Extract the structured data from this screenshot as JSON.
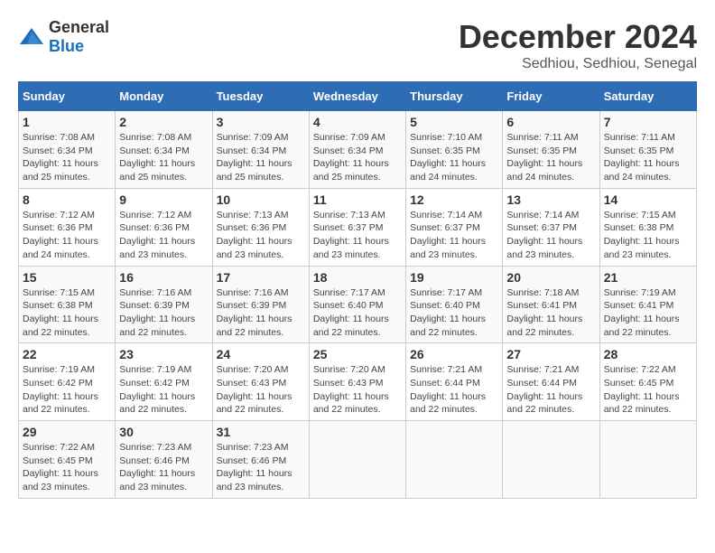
{
  "logo": {
    "general": "General",
    "blue": "Blue"
  },
  "title": {
    "month": "December 2024",
    "location": "Sedhiou, Sedhiou, Senegal"
  },
  "headers": [
    "Sunday",
    "Monday",
    "Tuesday",
    "Wednesday",
    "Thursday",
    "Friday",
    "Saturday"
  ],
  "weeks": [
    [
      {
        "day": "1",
        "sunrise": "7:08 AM",
        "sunset": "6:34 PM",
        "daylight": "11 hours and 25 minutes."
      },
      {
        "day": "2",
        "sunrise": "7:08 AM",
        "sunset": "6:34 PM",
        "daylight": "11 hours and 25 minutes."
      },
      {
        "day": "3",
        "sunrise": "7:09 AM",
        "sunset": "6:34 PM",
        "daylight": "11 hours and 25 minutes."
      },
      {
        "day": "4",
        "sunrise": "7:09 AM",
        "sunset": "6:34 PM",
        "daylight": "11 hours and 25 minutes."
      },
      {
        "day": "5",
        "sunrise": "7:10 AM",
        "sunset": "6:35 PM",
        "daylight": "11 hours and 24 minutes."
      },
      {
        "day": "6",
        "sunrise": "7:11 AM",
        "sunset": "6:35 PM",
        "daylight": "11 hours and 24 minutes."
      },
      {
        "day": "7",
        "sunrise": "7:11 AM",
        "sunset": "6:35 PM",
        "daylight": "11 hours and 24 minutes."
      }
    ],
    [
      {
        "day": "8",
        "sunrise": "7:12 AM",
        "sunset": "6:36 PM",
        "daylight": "11 hours and 24 minutes."
      },
      {
        "day": "9",
        "sunrise": "7:12 AM",
        "sunset": "6:36 PM",
        "daylight": "11 hours and 23 minutes."
      },
      {
        "day": "10",
        "sunrise": "7:13 AM",
        "sunset": "6:36 PM",
        "daylight": "11 hours and 23 minutes."
      },
      {
        "day": "11",
        "sunrise": "7:13 AM",
        "sunset": "6:37 PM",
        "daylight": "11 hours and 23 minutes."
      },
      {
        "day": "12",
        "sunrise": "7:14 AM",
        "sunset": "6:37 PM",
        "daylight": "11 hours and 23 minutes."
      },
      {
        "day": "13",
        "sunrise": "7:14 AM",
        "sunset": "6:37 PM",
        "daylight": "11 hours and 23 minutes."
      },
      {
        "day": "14",
        "sunrise": "7:15 AM",
        "sunset": "6:38 PM",
        "daylight": "11 hours and 23 minutes."
      }
    ],
    [
      {
        "day": "15",
        "sunrise": "7:15 AM",
        "sunset": "6:38 PM",
        "daylight": "11 hours and 22 minutes."
      },
      {
        "day": "16",
        "sunrise": "7:16 AM",
        "sunset": "6:39 PM",
        "daylight": "11 hours and 22 minutes."
      },
      {
        "day": "17",
        "sunrise": "7:16 AM",
        "sunset": "6:39 PM",
        "daylight": "11 hours and 22 minutes."
      },
      {
        "day": "18",
        "sunrise": "7:17 AM",
        "sunset": "6:40 PM",
        "daylight": "11 hours and 22 minutes."
      },
      {
        "day": "19",
        "sunrise": "7:17 AM",
        "sunset": "6:40 PM",
        "daylight": "11 hours and 22 minutes."
      },
      {
        "day": "20",
        "sunrise": "7:18 AM",
        "sunset": "6:41 PM",
        "daylight": "11 hours and 22 minutes."
      },
      {
        "day": "21",
        "sunrise": "7:19 AM",
        "sunset": "6:41 PM",
        "daylight": "11 hours and 22 minutes."
      }
    ],
    [
      {
        "day": "22",
        "sunrise": "7:19 AM",
        "sunset": "6:42 PM",
        "daylight": "11 hours and 22 minutes."
      },
      {
        "day": "23",
        "sunrise": "7:19 AM",
        "sunset": "6:42 PM",
        "daylight": "11 hours and 22 minutes."
      },
      {
        "day": "24",
        "sunrise": "7:20 AM",
        "sunset": "6:43 PM",
        "daylight": "11 hours and 22 minutes."
      },
      {
        "day": "25",
        "sunrise": "7:20 AM",
        "sunset": "6:43 PM",
        "daylight": "11 hours and 22 minutes."
      },
      {
        "day": "26",
        "sunrise": "7:21 AM",
        "sunset": "6:44 PM",
        "daylight": "11 hours and 22 minutes."
      },
      {
        "day": "27",
        "sunrise": "7:21 AM",
        "sunset": "6:44 PM",
        "daylight": "11 hours and 22 minutes."
      },
      {
        "day": "28",
        "sunrise": "7:22 AM",
        "sunset": "6:45 PM",
        "daylight": "11 hours and 22 minutes."
      }
    ],
    [
      {
        "day": "29",
        "sunrise": "7:22 AM",
        "sunset": "6:45 PM",
        "daylight": "11 hours and 23 minutes."
      },
      {
        "day": "30",
        "sunrise": "7:23 AM",
        "sunset": "6:46 PM",
        "daylight": "11 hours and 23 minutes."
      },
      {
        "day": "31",
        "sunrise": "7:23 AM",
        "sunset": "6:46 PM",
        "daylight": "11 hours and 23 minutes."
      },
      null,
      null,
      null,
      null
    ]
  ]
}
